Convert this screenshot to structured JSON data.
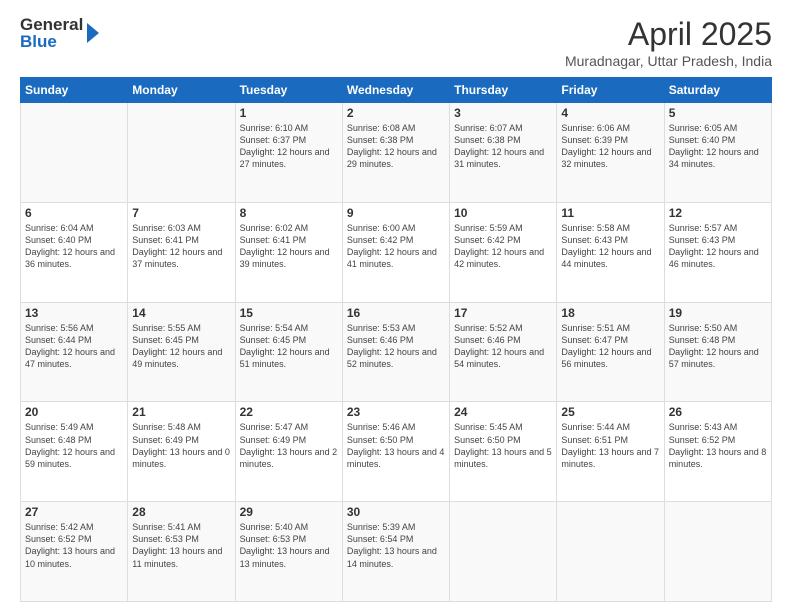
{
  "header": {
    "logo_line1": "General",
    "logo_line2": "Blue",
    "month_title": "April 2025",
    "location": "Muradnagar, Uttar Pradesh, India"
  },
  "days_of_week": [
    "Sunday",
    "Monday",
    "Tuesday",
    "Wednesday",
    "Thursday",
    "Friday",
    "Saturday"
  ],
  "weeks": [
    [
      {
        "day": "",
        "sunrise": "",
        "sunset": "",
        "daylight": ""
      },
      {
        "day": "",
        "sunrise": "",
        "sunset": "",
        "daylight": ""
      },
      {
        "day": "1",
        "sunrise": "Sunrise: 6:10 AM",
        "sunset": "Sunset: 6:37 PM",
        "daylight": "Daylight: 12 hours and 27 minutes."
      },
      {
        "day": "2",
        "sunrise": "Sunrise: 6:08 AM",
        "sunset": "Sunset: 6:38 PM",
        "daylight": "Daylight: 12 hours and 29 minutes."
      },
      {
        "day": "3",
        "sunrise": "Sunrise: 6:07 AM",
        "sunset": "Sunset: 6:38 PM",
        "daylight": "Daylight: 12 hours and 31 minutes."
      },
      {
        "day": "4",
        "sunrise": "Sunrise: 6:06 AM",
        "sunset": "Sunset: 6:39 PM",
        "daylight": "Daylight: 12 hours and 32 minutes."
      },
      {
        "day": "5",
        "sunrise": "Sunrise: 6:05 AM",
        "sunset": "Sunset: 6:40 PM",
        "daylight": "Daylight: 12 hours and 34 minutes."
      }
    ],
    [
      {
        "day": "6",
        "sunrise": "Sunrise: 6:04 AM",
        "sunset": "Sunset: 6:40 PM",
        "daylight": "Daylight: 12 hours and 36 minutes."
      },
      {
        "day": "7",
        "sunrise": "Sunrise: 6:03 AM",
        "sunset": "Sunset: 6:41 PM",
        "daylight": "Daylight: 12 hours and 37 minutes."
      },
      {
        "day": "8",
        "sunrise": "Sunrise: 6:02 AM",
        "sunset": "Sunset: 6:41 PM",
        "daylight": "Daylight: 12 hours and 39 minutes."
      },
      {
        "day": "9",
        "sunrise": "Sunrise: 6:00 AM",
        "sunset": "Sunset: 6:42 PM",
        "daylight": "Daylight: 12 hours and 41 minutes."
      },
      {
        "day": "10",
        "sunrise": "Sunrise: 5:59 AM",
        "sunset": "Sunset: 6:42 PM",
        "daylight": "Daylight: 12 hours and 42 minutes."
      },
      {
        "day": "11",
        "sunrise": "Sunrise: 5:58 AM",
        "sunset": "Sunset: 6:43 PM",
        "daylight": "Daylight: 12 hours and 44 minutes."
      },
      {
        "day": "12",
        "sunrise": "Sunrise: 5:57 AM",
        "sunset": "Sunset: 6:43 PM",
        "daylight": "Daylight: 12 hours and 46 minutes."
      }
    ],
    [
      {
        "day": "13",
        "sunrise": "Sunrise: 5:56 AM",
        "sunset": "Sunset: 6:44 PM",
        "daylight": "Daylight: 12 hours and 47 minutes."
      },
      {
        "day": "14",
        "sunrise": "Sunrise: 5:55 AM",
        "sunset": "Sunset: 6:45 PM",
        "daylight": "Daylight: 12 hours and 49 minutes."
      },
      {
        "day": "15",
        "sunrise": "Sunrise: 5:54 AM",
        "sunset": "Sunset: 6:45 PM",
        "daylight": "Daylight: 12 hours and 51 minutes."
      },
      {
        "day": "16",
        "sunrise": "Sunrise: 5:53 AM",
        "sunset": "Sunset: 6:46 PM",
        "daylight": "Daylight: 12 hours and 52 minutes."
      },
      {
        "day": "17",
        "sunrise": "Sunrise: 5:52 AM",
        "sunset": "Sunset: 6:46 PM",
        "daylight": "Daylight: 12 hours and 54 minutes."
      },
      {
        "day": "18",
        "sunrise": "Sunrise: 5:51 AM",
        "sunset": "Sunset: 6:47 PM",
        "daylight": "Daylight: 12 hours and 56 minutes."
      },
      {
        "day": "19",
        "sunrise": "Sunrise: 5:50 AM",
        "sunset": "Sunset: 6:48 PM",
        "daylight": "Daylight: 12 hours and 57 minutes."
      }
    ],
    [
      {
        "day": "20",
        "sunrise": "Sunrise: 5:49 AM",
        "sunset": "Sunset: 6:48 PM",
        "daylight": "Daylight: 12 hours and 59 minutes."
      },
      {
        "day": "21",
        "sunrise": "Sunrise: 5:48 AM",
        "sunset": "Sunset: 6:49 PM",
        "daylight": "Daylight: 13 hours and 0 minutes."
      },
      {
        "day": "22",
        "sunrise": "Sunrise: 5:47 AM",
        "sunset": "Sunset: 6:49 PM",
        "daylight": "Daylight: 13 hours and 2 minutes."
      },
      {
        "day": "23",
        "sunrise": "Sunrise: 5:46 AM",
        "sunset": "Sunset: 6:50 PM",
        "daylight": "Daylight: 13 hours and 4 minutes."
      },
      {
        "day": "24",
        "sunrise": "Sunrise: 5:45 AM",
        "sunset": "Sunset: 6:50 PM",
        "daylight": "Daylight: 13 hours and 5 minutes."
      },
      {
        "day": "25",
        "sunrise": "Sunrise: 5:44 AM",
        "sunset": "Sunset: 6:51 PM",
        "daylight": "Daylight: 13 hours and 7 minutes."
      },
      {
        "day": "26",
        "sunrise": "Sunrise: 5:43 AM",
        "sunset": "Sunset: 6:52 PM",
        "daylight": "Daylight: 13 hours and 8 minutes."
      }
    ],
    [
      {
        "day": "27",
        "sunrise": "Sunrise: 5:42 AM",
        "sunset": "Sunset: 6:52 PM",
        "daylight": "Daylight: 13 hours and 10 minutes."
      },
      {
        "day": "28",
        "sunrise": "Sunrise: 5:41 AM",
        "sunset": "Sunset: 6:53 PM",
        "daylight": "Daylight: 13 hours and 11 minutes."
      },
      {
        "day": "29",
        "sunrise": "Sunrise: 5:40 AM",
        "sunset": "Sunset: 6:53 PM",
        "daylight": "Daylight: 13 hours and 13 minutes."
      },
      {
        "day": "30",
        "sunrise": "Sunrise: 5:39 AM",
        "sunset": "Sunset: 6:54 PM",
        "daylight": "Daylight: 13 hours and 14 minutes."
      },
      {
        "day": "",
        "sunrise": "",
        "sunset": "",
        "daylight": ""
      },
      {
        "day": "",
        "sunrise": "",
        "sunset": "",
        "daylight": ""
      },
      {
        "day": "",
        "sunrise": "",
        "sunset": "",
        "daylight": ""
      }
    ]
  ]
}
